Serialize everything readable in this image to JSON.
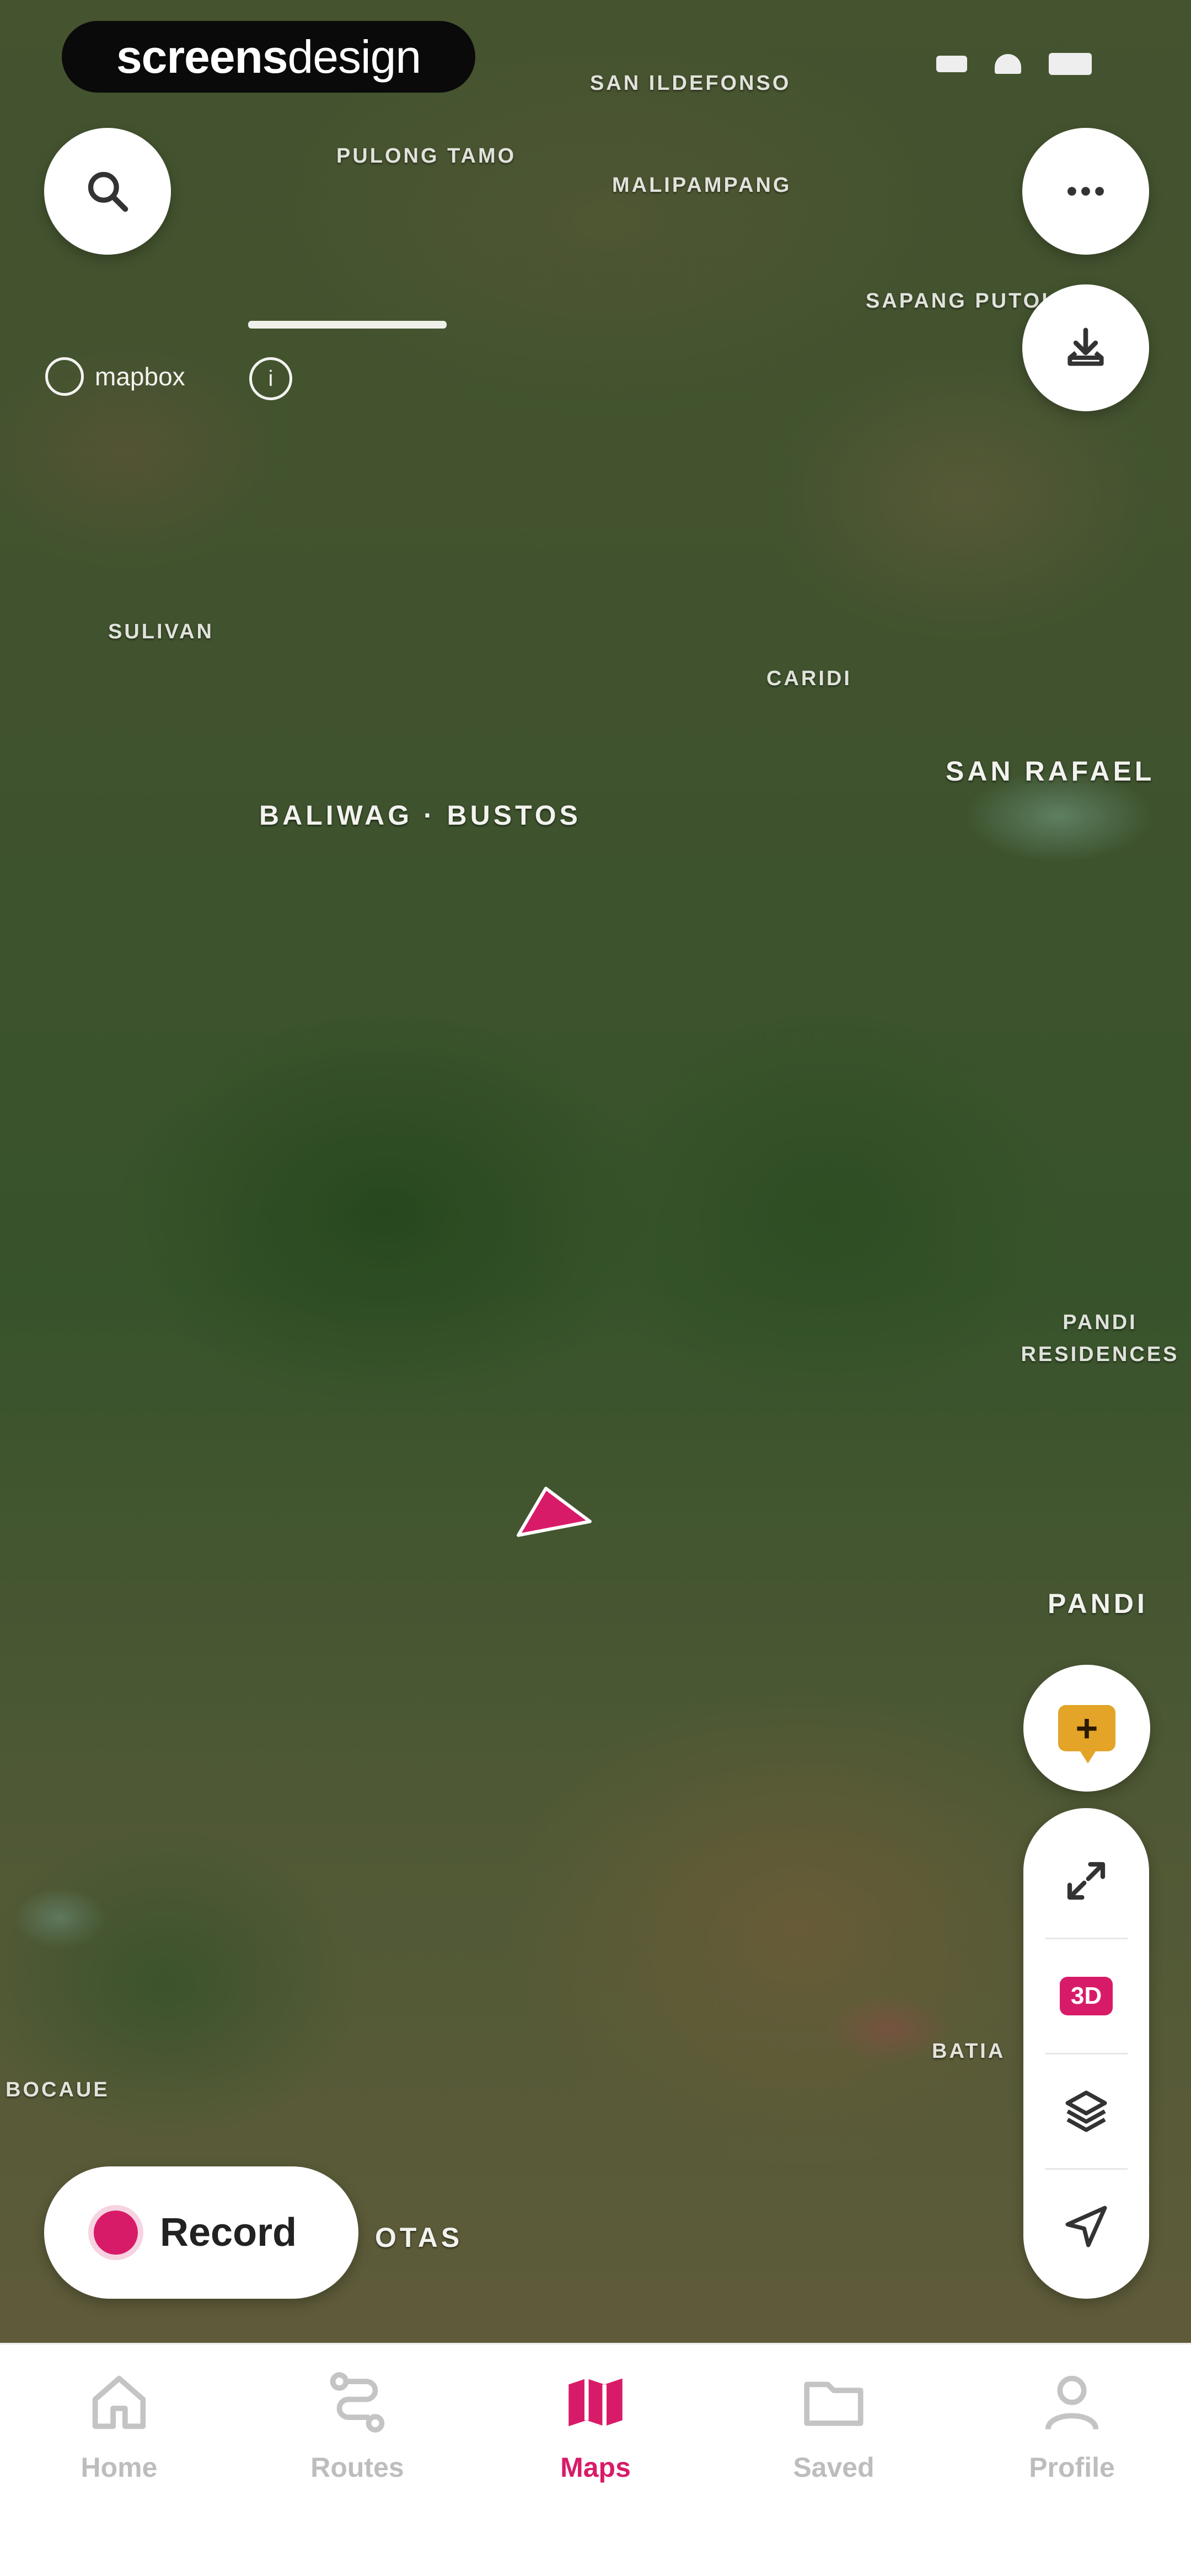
{
  "brand": {
    "text_bold": "screens",
    "text_light": "design"
  },
  "map": {
    "places": [
      "SAN ILDEFONSO",
      "PULONG TAMO",
      "MALIPAMPANG",
      "SAPANG PUTOL",
      "SULIVAN",
      "CARIDI",
      "SAN RAFAEL",
      "BALIWAG · BUSTOS",
      "PANDI RESIDENCES",
      "PANDI",
      "BATIA",
      "BOCAUE",
      "OTAS"
    ],
    "attribution": "mapbox",
    "info_symbol": "i"
  },
  "buttons": {
    "search": "search-icon",
    "more": "more-icon",
    "download": "download-icon",
    "add_note": "+",
    "expand": "expand-icon",
    "three_d": "3D",
    "layers": "layers-icon",
    "locate": "locate-icon"
  },
  "record": {
    "label": "Record"
  },
  "tabbar": {
    "tabs": [
      {
        "label": "Home",
        "icon": "home-icon"
      },
      {
        "label": "Routes",
        "icon": "routes-icon"
      },
      {
        "label": "Maps",
        "icon": "map-icon",
        "active": true
      },
      {
        "label": "Saved",
        "icon": "folder-icon"
      },
      {
        "label": "Profile",
        "icon": "profile-icon"
      }
    ]
  },
  "colors": {
    "accent": "#d81b68",
    "note": "#e3a428"
  }
}
